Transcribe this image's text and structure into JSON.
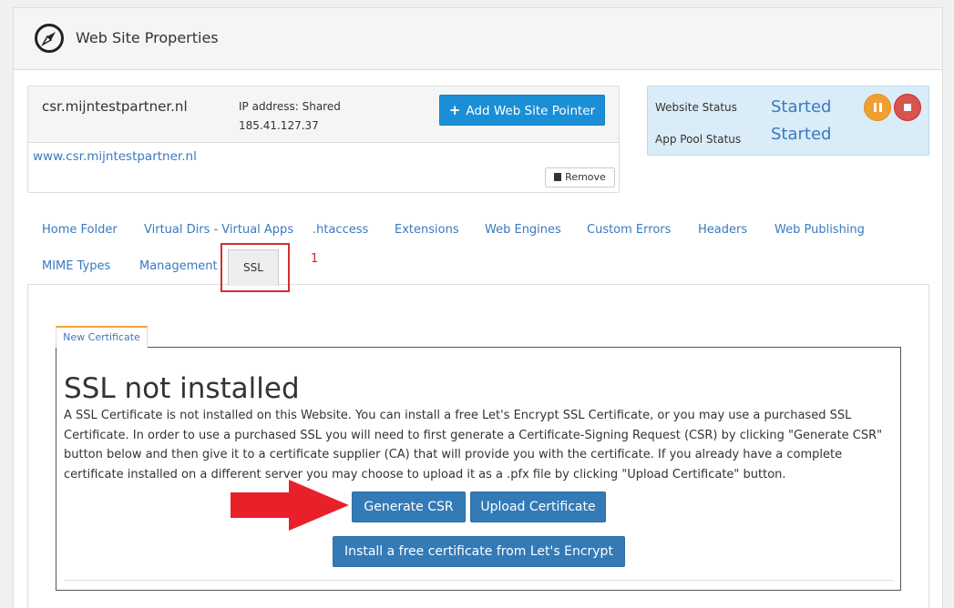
{
  "panel": {
    "title": "Web Site Properties",
    "icon": "compass-icon"
  },
  "site": {
    "name": "csr.mijntestpartner.nl",
    "ip_label": "IP address: Shared",
    "ip_value": "185.41.127.37",
    "add_pointer_label": "Add Web Site Pointer",
    "pointer_url": "www.csr.mijntestpartner.nl",
    "remove_label": "Remove"
  },
  "status": {
    "website_label": "Website Status",
    "website_value": "Started",
    "apppool_label": "App Pool Status",
    "apppool_value": "Started"
  },
  "tabs": {
    "row1": [
      "Home Folder",
      "Virtual Dirs - Virtual Apps",
      ".htaccess",
      "Extensions",
      "Web Engines",
      "Custom Errors",
      "Headers",
      "Web Publishing"
    ],
    "row2": [
      "MIME Types",
      "Management"
    ],
    "active": "SSL"
  },
  "annotation": {
    "number": "1"
  },
  "ssl": {
    "subtab": "New Certificate",
    "heading": "SSL not installed",
    "description": "A SSL Certificate is not installed on this Website. You can install a free Let's Encrypt SSL Certificate, or you may use a purchased SSL Certificate. In order to use a purchased SSL you will need to first generate a Certificate-Signing Request (CSR) by clicking \"Generate CSR\" button below and then give it to a certificate supplier (CA) that will provide you with the certificate. If you already have a complete certificate installed on a different server you may choose to upload it as a .pfx file by clicking \"Upload Certificate\" button.",
    "generate_label": "Generate CSR",
    "upload_label": "Upload Certificate",
    "letsencrypt_label": "Install a free certificate from Let's Encrypt"
  },
  "colors": {
    "link": "#3a79bf",
    "primary_button": "#337ab7",
    "add_button": "#1a8fd6",
    "status_bg": "#d9ecf7",
    "pause": "#f0a033",
    "stop": "#d9534f",
    "annotation": "#d32f2f"
  }
}
